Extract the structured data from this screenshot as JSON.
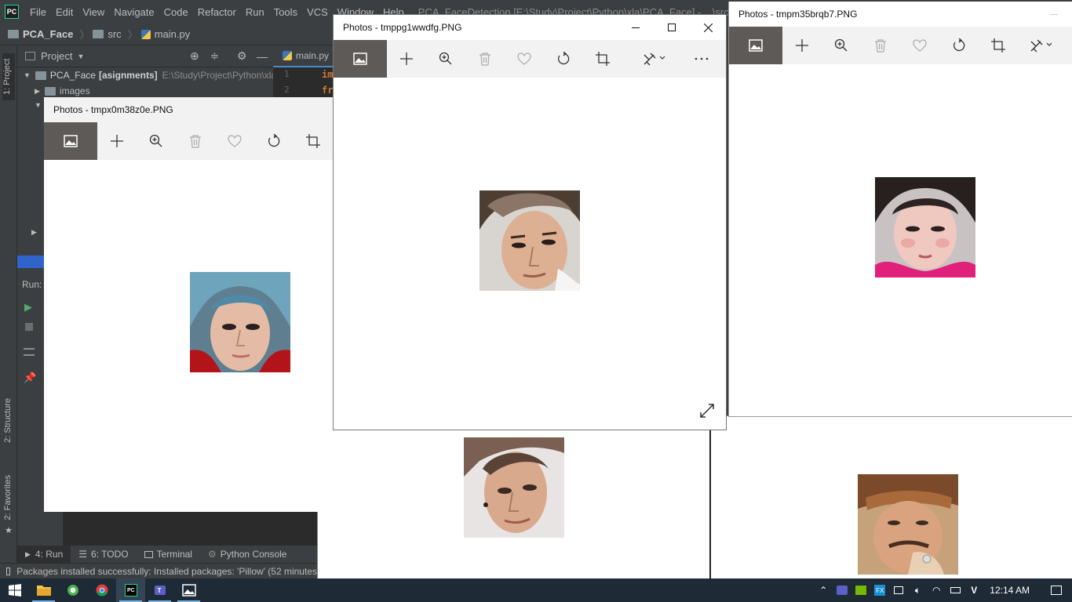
{
  "ide": {
    "logo": "PC",
    "menu": [
      "File",
      "Edit",
      "View",
      "Navigate",
      "Code",
      "Refactor",
      "Run",
      "Tools",
      "VCS",
      "Window",
      "Help"
    ],
    "title": "PCA_FaceDetection [E:\\Study\\Project\\Python\\xla\\PCA_Face] - ...\\src\\main.py - PyC",
    "breadcrumb": [
      "PCA_Face",
      "src",
      "main.py"
    ],
    "project_panel_label": "Project",
    "tree": {
      "root_name": "PCA_Face",
      "root_suffix": "[asignments]",
      "root_path": "E:\\Study\\Project\\Python\\xla\\",
      "images": "images"
    },
    "editor_tab": "main.py",
    "line_numbers": [
      "1",
      "2"
    ],
    "code_fragments": [
      "im",
      "fr"
    ],
    "left_tabs": [
      "1: Project",
      "2: Structure",
      "2: Favorites"
    ],
    "run_label": "Run:",
    "bottom_tabs": [
      "4: Run",
      "6: TODO",
      "Terminal",
      "Python Console"
    ],
    "status": "Packages installed successfully: Installed packages: 'Pillow' (52 minutes"
  },
  "windows": {
    "photos_left": {
      "title": "Photos - tmpx0m38z0e.PNG",
      "face": "person-blue-hair"
    },
    "photos_center": {
      "title": "Photos - tmppg1wwdfg.PNG",
      "face": "person-center"
    },
    "photos_right": {
      "title": "Photos - tmpm35brqb7.PNG",
      "face": "person-pink-shirt"
    },
    "photos_behind_mid": {
      "title_fragment": "P",
      "face": "person-earring"
    },
    "photos_behind_right": {
      "face": "person-cap"
    }
  },
  "taskbar": {
    "time": "12:14 AM",
    "apps": [
      "file-explorer-icon",
      "green-app-icon",
      "chrome-icon",
      "pycharm-icon",
      "teams-icon",
      "photos-icon"
    ]
  },
  "colors": {
    "ide_bg": "#3c3f41",
    "photos_toolbar": "#f2f2f2",
    "photos_home": "#5d5a58",
    "taskbar": "#1e2a36"
  }
}
